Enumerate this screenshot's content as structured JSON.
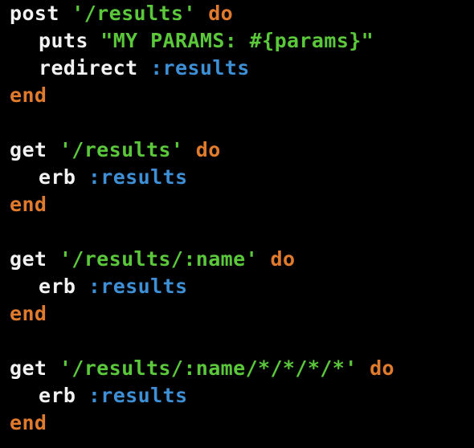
{
  "colors": {
    "background": "#000000",
    "plain": "#f2f2f2",
    "keyword": "#e07b2d",
    "string": "#5bc73b",
    "symbol": "#3d8fd6"
  },
  "code": {
    "lines": [
      {
        "tokens": [
          {
            "t": "plain",
            "v": "post"
          },
          {
            "t": "plain",
            "v": " "
          },
          {
            "t": "string",
            "v": "'/results'"
          },
          {
            "t": "plain",
            "v": " "
          },
          {
            "t": "keyword",
            "v": "do"
          }
        ]
      },
      {
        "indent": true,
        "tokens": [
          {
            "t": "plain",
            "v": "puts"
          },
          {
            "t": "plain",
            "v": " "
          },
          {
            "t": "string",
            "v": "\"MY PARAMS: #{params}\""
          }
        ]
      },
      {
        "indent": true,
        "tokens": [
          {
            "t": "plain",
            "v": "redirect"
          },
          {
            "t": "plain",
            "v": " "
          },
          {
            "t": "symbol",
            "v": ":results"
          }
        ]
      },
      {
        "tokens": [
          {
            "t": "keyword",
            "v": "end"
          }
        ]
      },
      {
        "tokens": []
      },
      {
        "tokens": [
          {
            "t": "plain",
            "v": "get"
          },
          {
            "t": "plain",
            "v": " "
          },
          {
            "t": "string",
            "v": "'/results'"
          },
          {
            "t": "plain",
            "v": " "
          },
          {
            "t": "keyword",
            "v": "do"
          }
        ]
      },
      {
        "indent": true,
        "tokens": [
          {
            "t": "plain",
            "v": "erb"
          },
          {
            "t": "plain",
            "v": " "
          },
          {
            "t": "symbol",
            "v": ":results"
          }
        ]
      },
      {
        "tokens": [
          {
            "t": "keyword",
            "v": "end"
          }
        ]
      },
      {
        "tokens": []
      },
      {
        "tokens": [
          {
            "t": "plain",
            "v": "get"
          },
          {
            "t": "plain",
            "v": " "
          },
          {
            "t": "string",
            "v": "'/results/:name'"
          },
          {
            "t": "plain",
            "v": " "
          },
          {
            "t": "keyword",
            "v": "do"
          }
        ]
      },
      {
        "indent": true,
        "tokens": [
          {
            "t": "plain",
            "v": "erb"
          },
          {
            "t": "plain",
            "v": " "
          },
          {
            "t": "symbol",
            "v": ":results"
          }
        ]
      },
      {
        "tokens": [
          {
            "t": "keyword",
            "v": "end"
          }
        ]
      },
      {
        "tokens": []
      },
      {
        "tokens": [
          {
            "t": "plain",
            "v": "get"
          },
          {
            "t": "plain",
            "v": " "
          },
          {
            "t": "string",
            "v": "'/results/:name/*/*/*/*'"
          },
          {
            "t": "plain",
            "v": " "
          },
          {
            "t": "keyword",
            "v": "do"
          }
        ]
      },
      {
        "indent": true,
        "tokens": [
          {
            "t": "plain",
            "v": "erb"
          },
          {
            "t": "plain",
            "v": " "
          },
          {
            "t": "symbol",
            "v": ":results"
          }
        ]
      },
      {
        "tokens": [
          {
            "t": "keyword",
            "v": "end"
          }
        ]
      }
    ]
  }
}
